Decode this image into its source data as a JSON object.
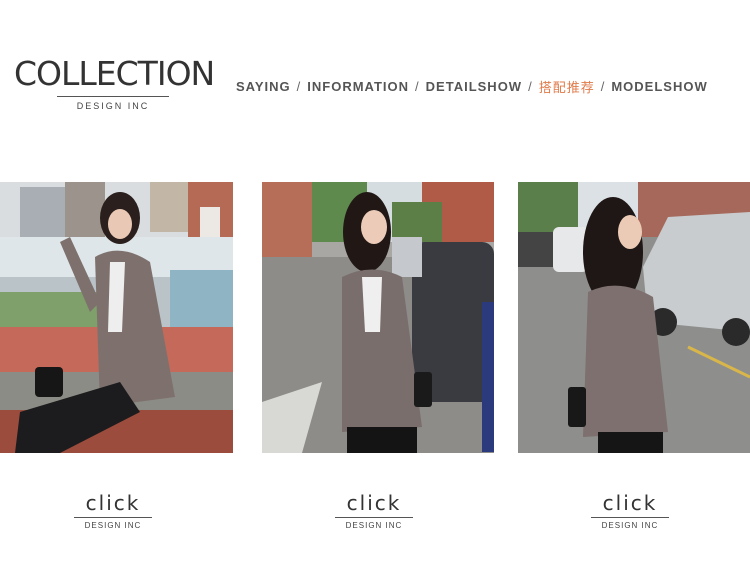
{
  "brand": {
    "title": "COLLECTION",
    "subtitle": "DESIGN INC"
  },
  "nav": {
    "items": [
      "SAYING",
      "INFORMATION",
      "DETAILSHOW",
      "搭配推荐",
      "MODELSHOW"
    ],
    "separator": "/",
    "active_index": 3,
    "active_color": "#e07a4a"
  },
  "photos": [
    {
      "icon": "model-photo-seated"
    },
    {
      "icon": "model-photo-standing-street"
    },
    {
      "icon": "model-photo-side-street"
    }
  ],
  "click_buttons": [
    {
      "label": "click",
      "sub": "DESIGN INC"
    },
    {
      "label": "click",
      "sub": "DESIGN INC"
    },
    {
      "label": "click",
      "sub": "DESIGN INC"
    }
  ]
}
